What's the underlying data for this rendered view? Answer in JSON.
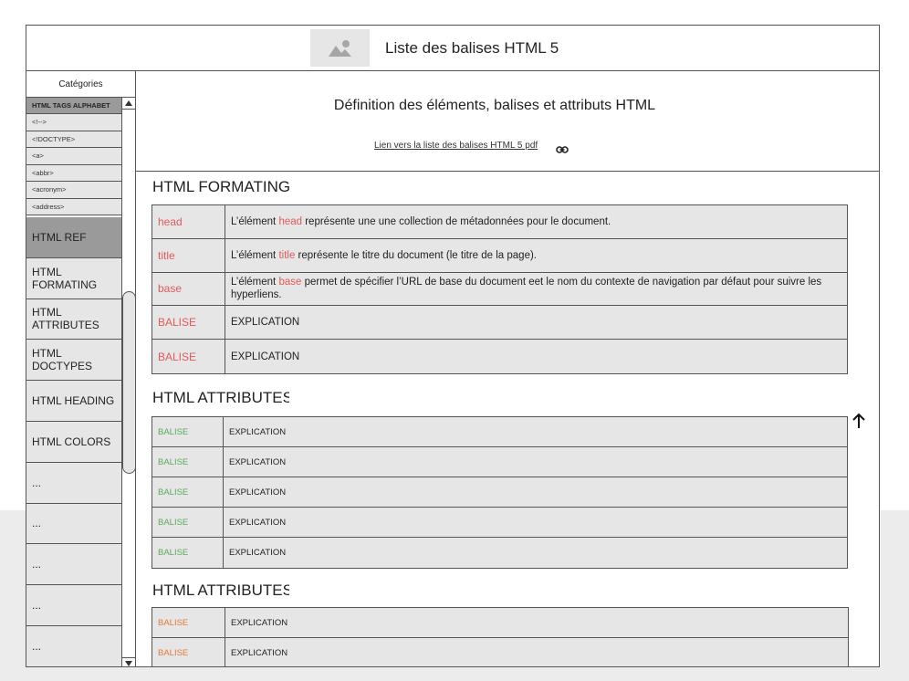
{
  "header": {
    "title": "Liste des balises HTML 5",
    "logo_icon": "image-placeholder-icon"
  },
  "sidebar": {
    "heading": "Catégories",
    "alphabet_title": "HTML TAGS ALPHABET",
    "alphabet_items": [
      "<!-->",
      "<!DOCTYPE>",
      "<a>",
      "<abbr>",
      "<acronym>",
      "<address>"
    ],
    "nav_items": [
      {
        "label": "HTML REF"
      },
      {
        "label": "HTML FORMATING"
      },
      {
        "label": "HTML ATTRIBUTES"
      },
      {
        "label": "HTML DOCTYPES"
      },
      {
        "label": "HTML HEADING"
      },
      {
        "label": "HTML COLORS"
      },
      {
        "label": "..."
      },
      {
        "label": "..."
      },
      {
        "label": "..."
      },
      {
        "label": "..."
      },
      {
        "label": "..."
      }
    ]
  },
  "main": {
    "title": "Définition des éléments, balises et attributs HTML",
    "pdf_link": "Lien vers la liste des balises HTML 5 pdf",
    "sections": [
      {
        "title": "HTML FORMATING:",
        "rows": [
          {
            "tag": "head",
            "desc_before": "L’élément ",
            "desc_tag": "head",
            "desc_after": " représente une une collection de métadonnées pour le document."
          },
          {
            "tag": "title",
            "desc_before": "L’élément ",
            "desc_tag": "title",
            "desc_after": " représente le titre du document (le titre de la page)."
          },
          {
            "tag": "base",
            "desc_before": "L’élément ",
            "desc_tag": "base",
            "desc_after": " permet de spécifier l’URL de base du document eet le nom du contexte de navigation par défaut pour suivre les hyperliens."
          },
          {
            "tag": "BALISE",
            "desc_before": "EXPLICATION",
            "desc_tag": "",
            "desc_after": ""
          },
          {
            "tag": "BALISE",
            "desc_before": "EXPLICATION",
            "desc_tag": "",
            "desc_after": ""
          }
        ]
      },
      {
        "title": "HTML ATTRIBUTES",
        "rows": [
          {
            "tag": "BALISE",
            "desc": "EXPLICATION"
          },
          {
            "tag": "BALISE",
            "desc": "EXPLICATION"
          },
          {
            "tag": "BALISE",
            "desc": "EXPLICATION"
          },
          {
            "tag": "BALISE",
            "desc": "EXPLICATION"
          },
          {
            "tag": "BALISE",
            "desc": "EXPLICATION"
          }
        ]
      },
      {
        "title": "HTML ATTRIBUTES",
        "rows": [
          {
            "tag": "BALISE",
            "desc": "EXPLICATION"
          },
          {
            "tag": "BALISE",
            "desc": "EXPLICATION"
          }
        ]
      }
    ]
  },
  "colors": {
    "tag_red": "#e05a5a",
    "tag_green": "#5aaa5a",
    "tag_orange": "#e07a3a",
    "cell_bg": "#e6e6e6",
    "active_bg": "#9a9a9a"
  },
  "icons": [
    "image-placeholder-icon",
    "link-icon",
    "arrow-up-icon",
    "scroll-up-icon",
    "scroll-down-icon"
  ]
}
